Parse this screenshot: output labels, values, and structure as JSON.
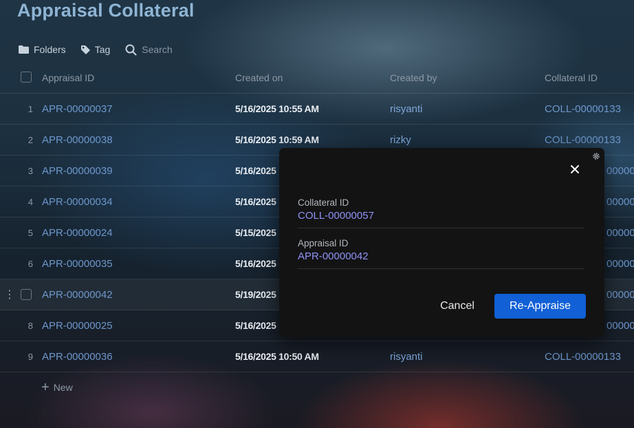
{
  "page": {
    "title": "Appraisal Collateral"
  },
  "toolbar": {
    "folders": "Folders",
    "tag": "Tag",
    "search_placeholder": "Search"
  },
  "table": {
    "headers": {
      "appraisal_id": "Appraisal ID",
      "created_on": "Created on",
      "created_by": "Created by",
      "collateral_id": "Collateral ID"
    },
    "rows": [
      {
        "num": "1",
        "appraisal_id": "APR-00000037",
        "created_on": "5/16/2025 10:55 AM",
        "created_by": "risyanti",
        "collateral_id": "COLL-00000133"
      },
      {
        "num": "2",
        "appraisal_id": "APR-00000038",
        "created_on": "5/16/2025 10:59 AM",
        "created_by": "rizky",
        "collateral_id": "COLL-00000133"
      },
      {
        "num": "3",
        "appraisal_id": "APR-00000039",
        "created_on": "5/16/2025",
        "created_by": "",
        "collateral_id": "00000133"
      },
      {
        "num": "4",
        "appraisal_id": "APR-00000034",
        "created_on": "5/16/2025",
        "created_by": "",
        "collateral_id": "00000133"
      },
      {
        "num": "5",
        "appraisal_id": "APR-00000024",
        "created_on": "5/15/2025",
        "created_by": "",
        "collateral_id": "00000057"
      },
      {
        "num": "6",
        "appraisal_id": "APR-00000035",
        "created_on": "5/16/2025",
        "created_by": "",
        "collateral_id": "00000133"
      },
      {
        "num": "",
        "appraisal_id": "APR-00000042",
        "created_on": "5/19/2025",
        "created_by": "",
        "collateral_id": "00000057"
      },
      {
        "num": "8",
        "appraisal_id": "APR-00000025",
        "created_on": "5/16/2025",
        "created_by": "",
        "collateral_id": "00000133"
      },
      {
        "num": "9",
        "appraisal_id": "APR-00000036",
        "created_on": "5/16/2025 10:50 AM",
        "created_by": "risyanti",
        "collateral_id": "COLL-00000133"
      }
    ],
    "new_label": "New"
  },
  "modal": {
    "collateral_label": "Collateral ID",
    "collateral_value": "COLL-00000057",
    "appraisal_label": "Appraisal ID",
    "appraisal_value": "APR-00000042",
    "cancel_label": "Cancel",
    "primary_label": "Re-Appraise",
    "primary_color": "#1160d6"
  },
  "icons": {
    "folders": "folder-icon",
    "tag": "tag-icon",
    "search": "search-icon",
    "close": "close-icon",
    "settings": "gear-icon",
    "add": "plus-icon",
    "row_menu": "kebab-icon"
  }
}
